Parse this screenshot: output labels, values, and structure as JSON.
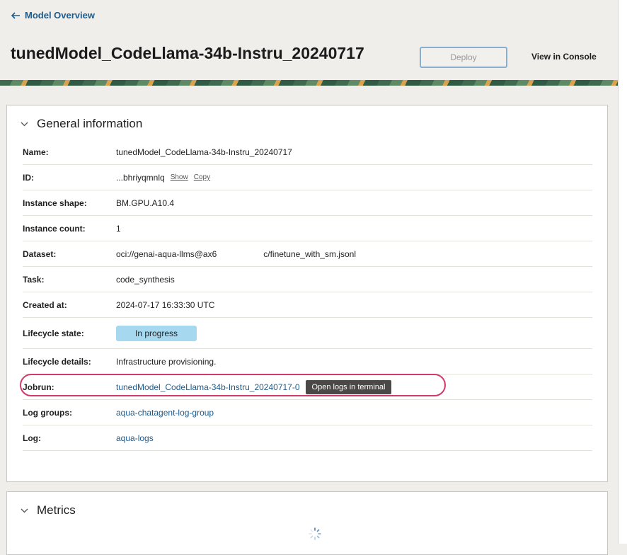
{
  "nav": {
    "back_label": "Model Overview"
  },
  "header": {
    "title": "tunedModel_CodeLlama-34b-Instru_20240717",
    "deploy_label": "Deploy",
    "console_label": "View in Console"
  },
  "general": {
    "section_title": "General information",
    "rows": [
      {
        "label": "Name:",
        "value": "tunedModel_CodeLlama-34b-Instru_20240717"
      },
      {
        "label": "ID:",
        "value": "...bhriyqmnlq",
        "show": "Show",
        "copy": "Copy"
      },
      {
        "label": "Instance shape:",
        "value": "BM.GPU.A10.4"
      },
      {
        "label": "Instance count:",
        "value": "1"
      },
      {
        "label": "Dataset:",
        "value_a": "oci://genai-aqua-llms@ax6",
        "value_b": "c/finetune_with_sm.jsonl"
      },
      {
        "label": "Task:",
        "value": "code_synthesis"
      },
      {
        "label": "Created at:",
        "value": "2024-07-17 16:33:30 UTC"
      },
      {
        "label": "Lifecycle state:",
        "value": "In progress"
      },
      {
        "label": "Lifecycle details:",
        "value": "Infrastructure provisioning."
      },
      {
        "label": "Jobrun:",
        "value": "tunedModel_CodeLlama-34b-Instru_20240717-0",
        "button": "Open logs in terminal"
      },
      {
        "label": "Log groups:",
        "value": "aqua-chatagent-log-group"
      },
      {
        "label": "Log:",
        "value": "aqua-logs"
      }
    ]
  },
  "metrics": {
    "section_title": "Metrics"
  },
  "colors": {
    "link": "#1d5b8c",
    "badge": "#a6d8f0",
    "highlight": "#d23a6c"
  },
  "icons": [
    "arrow-left-icon",
    "chevron-down-icon",
    "spinner-icon"
  ]
}
